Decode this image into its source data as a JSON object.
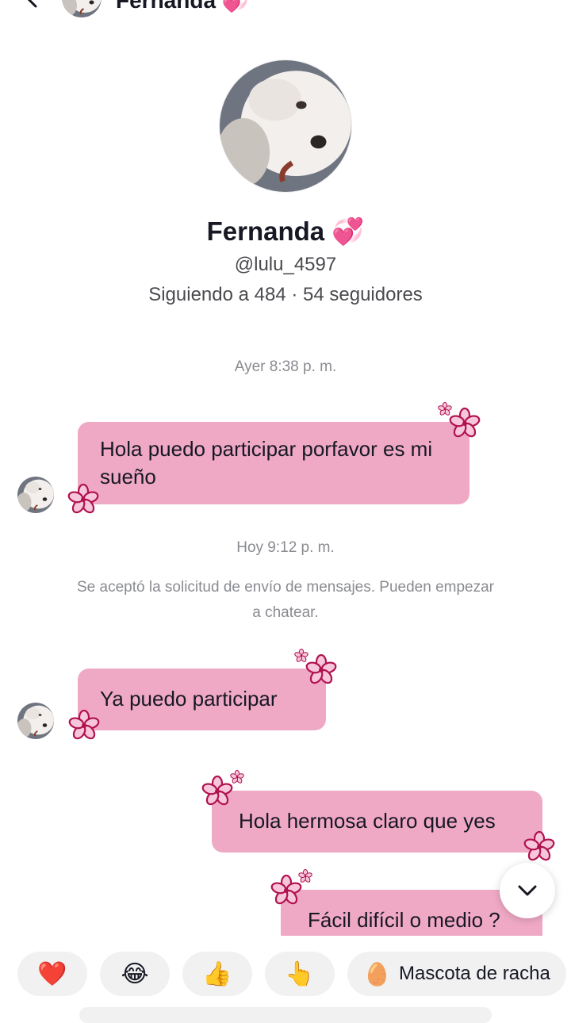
{
  "header": {
    "title": "Fernanda",
    "title_emoji": "💞"
  },
  "profile": {
    "name": "Fernanda",
    "name_emoji": "💞",
    "handle": "@lulu_4597",
    "stats": "Siguiendo a 484 · 54 seguidores"
  },
  "chat": {
    "timestamp_1": "Ayer 8:38 p. m.",
    "message_1": "Hola puedo participar porfavor es mi sueño",
    "timestamp_2": "Hoy 9:12 p. m.",
    "system_message": "Se aceptó la solicitud de envío de mensajes. Pueden empezar a chatear.",
    "message_2": "Ya puedo participar",
    "message_3": "Hola hermosa claro que yes",
    "message_4": "Fácil difícil o medio ?"
  },
  "quick_reactions": [
    {
      "emoji": "❤️",
      "icon": "heart-icon"
    },
    {
      "emoji": "😂",
      "icon": "laughing-face-icon"
    },
    {
      "emoji": "👍",
      "icon": "thumbs-up-icon"
    },
    {
      "emoji": "👆",
      "icon": "pointing-up-icon"
    }
  ],
  "streak_pet": {
    "emoji": "🥚",
    "label": "Mascota de racha"
  },
  "colors": {
    "bubble": "#f0a9c5",
    "flower": "#c2185b",
    "text": "#161823",
    "muted": "#8a8b91"
  }
}
